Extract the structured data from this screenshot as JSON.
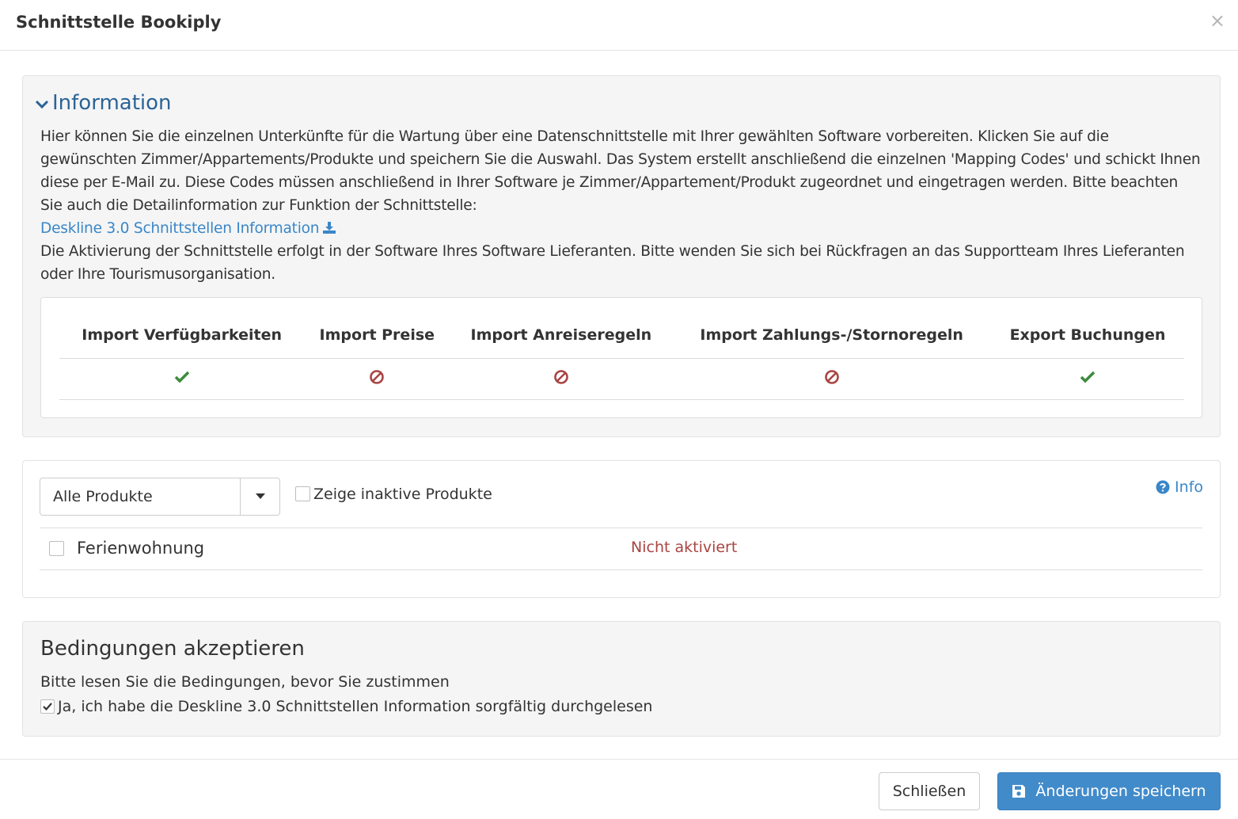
{
  "modal": {
    "title": "Schnittstelle Bookiply",
    "close_glyph": "×"
  },
  "information": {
    "heading": "Information",
    "paragraph1": "Hier können Sie die einzelnen Unterkünfte für die Wartung über eine Datenschnittstelle mit Ihrer gewählten Software vorbereiten. Klicken Sie auf die gewünschten Zimmer/Appartements/Produkte und speichern Sie die Auswahl. Das System erstellt anschließend die einzelnen 'Mapping Codes' und schickt Ihnen diese per E-Mail zu. Diese Codes müssen anschließend in Ihrer Software je Zimmer/Appartement/Produkt zugeordnet und eingetragen werden. Bitte beachten Sie auch die Detailinformation zur Funktion der Schnittstelle:",
    "doc_link": "Deskline 3.0 Schnittstellen Information",
    "paragraph2": "Die Aktivierung der Schnittstelle erfolgt in der Software Ihres Software Lieferanten. Bitte wenden Sie sich bei Rückfragen an das Supportteam Ihres Lieferanten oder Ihre Tourismusorganisation."
  },
  "features": {
    "columns": [
      "Import Verfügbarkeiten",
      "Import Preise",
      "Import Anreiseregeln",
      "Import Zahlungs-/Stornoregeln",
      "Export Buchungen"
    ],
    "status_icons": [
      "check-icon",
      "ban-icon",
      "ban-icon",
      "ban-icon",
      "check-icon"
    ]
  },
  "products": {
    "filter_selected": "Alle Produkte",
    "show_inactive_label": "Zeige inaktive Produkte",
    "info_link": "Info",
    "rows": [
      {
        "name": "Ferienwohnung",
        "status": "Nicht aktiviert",
        "checked": false
      }
    ]
  },
  "terms": {
    "title": "Bedingungen akzeptieren",
    "text": "Bitte lesen Sie die Bedingungen, bevor Sie zustimmen",
    "checkbox_label": "Ja, ich habe die Deskline 3.0 Schnittstellen Information sorgfältig durchgelesen",
    "checked": true
  },
  "footer": {
    "close_label": "Schließen",
    "save_label": "Änderungen speichern"
  },
  "colors": {
    "link": "#3a87c8",
    "heading": "#2a6496",
    "success": "#3c8a3c",
    "danger": "#a94442",
    "primary": "#428bca"
  }
}
